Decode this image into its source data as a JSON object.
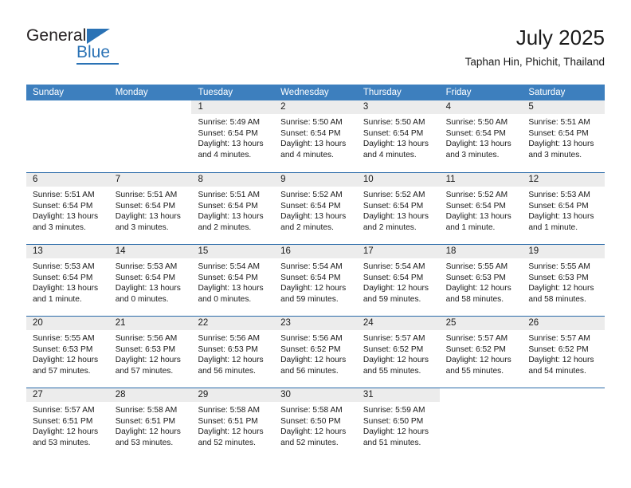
{
  "brand": {
    "name_part1": "General",
    "name_part2": "Blue",
    "triangle_icon": "triangle-icon",
    "accent_color": "#2a72b5"
  },
  "header": {
    "title": "July 2025",
    "subtitle": "Taphan Hin, Phichit, Thailand"
  },
  "colors": {
    "weekday_header_bg": "#3d7fbe",
    "weekday_header_text": "#ffffff",
    "day_number_band": "#ececec",
    "row_divider": "#2a6aa8",
    "text": "#1a1a1a"
  },
  "weekdays": [
    "Sunday",
    "Monday",
    "Tuesday",
    "Wednesday",
    "Thursday",
    "Friday",
    "Saturday"
  ],
  "weeks": [
    [
      {
        "day": "",
        "lines": []
      },
      {
        "day": "",
        "lines": []
      },
      {
        "day": "1",
        "lines": [
          "Sunrise: 5:49 AM",
          "Sunset: 6:54 PM",
          "Daylight: 13 hours",
          "and 4 minutes."
        ]
      },
      {
        "day": "2",
        "lines": [
          "Sunrise: 5:50 AM",
          "Sunset: 6:54 PM",
          "Daylight: 13 hours",
          "and 4 minutes."
        ]
      },
      {
        "day": "3",
        "lines": [
          "Sunrise: 5:50 AM",
          "Sunset: 6:54 PM",
          "Daylight: 13 hours",
          "and 4 minutes."
        ]
      },
      {
        "day": "4",
        "lines": [
          "Sunrise: 5:50 AM",
          "Sunset: 6:54 PM",
          "Daylight: 13 hours",
          "and 3 minutes."
        ]
      },
      {
        "day": "5",
        "lines": [
          "Sunrise: 5:51 AM",
          "Sunset: 6:54 PM",
          "Daylight: 13 hours",
          "and 3 minutes."
        ]
      }
    ],
    [
      {
        "day": "6",
        "lines": [
          "Sunrise: 5:51 AM",
          "Sunset: 6:54 PM",
          "Daylight: 13 hours",
          "and 3 minutes."
        ]
      },
      {
        "day": "7",
        "lines": [
          "Sunrise: 5:51 AM",
          "Sunset: 6:54 PM",
          "Daylight: 13 hours",
          "and 3 minutes."
        ]
      },
      {
        "day": "8",
        "lines": [
          "Sunrise: 5:51 AM",
          "Sunset: 6:54 PM",
          "Daylight: 13 hours",
          "and 2 minutes."
        ]
      },
      {
        "day": "9",
        "lines": [
          "Sunrise: 5:52 AM",
          "Sunset: 6:54 PM",
          "Daylight: 13 hours",
          "and 2 minutes."
        ]
      },
      {
        "day": "10",
        "lines": [
          "Sunrise: 5:52 AM",
          "Sunset: 6:54 PM",
          "Daylight: 13 hours",
          "and 2 minutes."
        ]
      },
      {
        "day": "11",
        "lines": [
          "Sunrise: 5:52 AM",
          "Sunset: 6:54 PM",
          "Daylight: 13 hours",
          "and 1 minute."
        ]
      },
      {
        "day": "12",
        "lines": [
          "Sunrise: 5:53 AM",
          "Sunset: 6:54 PM",
          "Daylight: 13 hours",
          "and 1 minute."
        ]
      }
    ],
    [
      {
        "day": "13",
        "lines": [
          "Sunrise: 5:53 AM",
          "Sunset: 6:54 PM",
          "Daylight: 13 hours",
          "and 1 minute."
        ]
      },
      {
        "day": "14",
        "lines": [
          "Sunrise: 5:53 AM",
          "Sunset: 6:54 PM",
          "Daylight: 13 hours",
          "and 0 minutes."
        ]
      },
      {
        "day": "15",
        "lines": [
          "Sunrise: 5:54 AM",
          "Sunset: 6:54 PM",
          "Daylight: 13 hours",
          "and 0 minutes."
        ]
      },
      {
        "day": "16",
        "lines": [
          "Sunrise: 5:54 AM",
          "Sunset: 6:54 PM",
          "Daylight: 12 hours",
          "and 59 minutes."
        ]
      },
      {
        "day": "17",
        "lines": [
          "Sunrise: 5:54 AM",
          "Sunset: 6:54 PM",
          "Daylight: 12 hours",
          "and 59 minutes."
        ]
      },
      {
        "day": "18",
        "lines": [
          "Sunrise: 5:55 AM",
          "Sunset: 6:53 PM",
          "Daylight: 12 hours",
          "and 58 minutes."
        ]
      },
      {
        "day": "19",
        "lines": [
          "Sunrise: 5:55 AM",
          "Sunset: 6:53 PM",
          "Daylight: 12 hours",
          "and 58 minutes."
        ]
      }
    ],
    [
      {
        "day": "20",
        "lines": [
          "Sunrise: 5:55 AM",
          "Sunset: 6:53 PM",
          "Daylight: 12 hours",
          "and 57 minutes."
        ]
      },
      {
        "day": "21",
        "lines": [
          "Sunrise: 5:56 AM",
          "Sunset: 6:53 PM",
          "Daylight: 12 hours",
          "and 57 minutes."
        ]
      },
      {
        "day": "22",
        "lines": [
          "Sunrise: 5:56 AM",
          "Sunset: 6:53 PM",
          "Daylight: 12 hours",
          "and 56 minutes."
        ]
      },
      {
        "day": "23",
        "lines": [
          "Sunrise: 5:56 AM",
          "Sunset: 6:52 PM",
          "Daylight: 12 hours",
          "and 56 minutes."
        ]
      },
      {
        "day": "24",
        "lines": [
          "Sunrise: 5:57 AM",
          "Sunset: 6:52 PM",
          "Daylight: 12 hours",
          "and 55 minutes."
        ]
      },
      {
        "day": "25",
        "lines": [
          "Sunrise: 5:57 AM",
          "Sunset: 6:52 PM",
          "Daylight: 12 hours",
          "and 55 minutes."
        ]
      },
      {
        "day": "26",
        "lines": [
          "Sunrise: 5:57 AM",
          "Sunset: 6:52 PM",
          "Daylight: 12 hours",
          "and 54 minutes."
        ]
      }
    ],
    [
      {
        "day": "27",
        "lines": [
          "Sunrise: 5:57 AM",
          "Sunset: 6:51 PM",
          "Daylight: 12 hours",
          "and 53 minutes."
        ]
      },
      {
        "day": "28",
        "lines": [
          "Sunrise: 5:58 AM",
          "Sunset: 6:51 PM",
          "Daylight: 12 hours",
          "and 53 minutes."
        ]
      },
      {
        "day": "29",
        "lines": [
          "Sunrise: 5:58 AM",
          "Sunset: 6:51 PM",
          "Daylight: 12 hours",
          "and 52 minutes."
        ]
      },
      {
        "day": "30",
        "lines": [
          "Sunrise: 5:58 AM",
          "Sunset: 6:50 PM",
          "Daylight: 12 hours",
          "and 52 minutes."
        ]
      },
      {
        "day": "31",
        "lines": [
          "Sunrise: 5:59 AM",
          "Sunset: 6:50 PM",
          "Daylight: 12 hours",
          "and 51 minutes."
        ]
      },
      {
        "day": "",
        "lines": []
      },
      {
        "day": "",
        "lines": []
      }
    ]
  ]
}
